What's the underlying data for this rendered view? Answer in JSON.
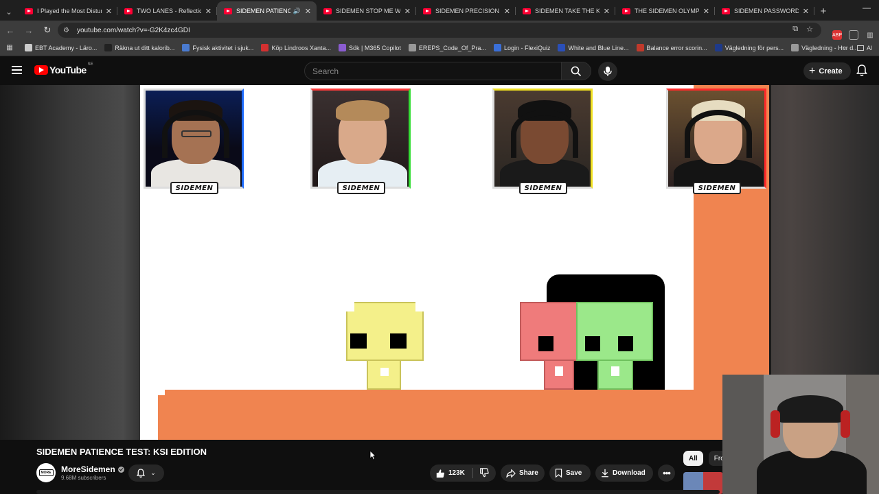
{
  "browser": {
    "tabs": [
      {
        "title": "I Played the Most Disturb",
        "active": false
      },
      {
        "title": "TWO LANES - Reflection",
        "active": false
      },
      {
        "title": "SIDEMEN PATIENCE T",
        "active": true
      },
      {
        "title": "SIDEMEN STOP ME WHE",
        "active": false
      },
      {
        "title": "SIDEMEN PRECISION TES",
        "active": false
      },
      {
        "title": "SIDEMEN TAKE THE KSI T",
        "active": false
      },
      {
        "title": "THE SIDEMEN OLYMPICS",
        "active": false
      },
      {
        "title": "SIDEMEN PASSWORD GA",
        "active": false
      }
    ],
    "url": "youtube.com/watch?v=-G2K4zc4GDI",
    "bookmarks": [
      {
        "label": "EBT Academy - Läro...",
        "color": "#cccccc"
      },
      {
        "label": "Räkna ut ditt kalorib...",
        "color": "#222222"
      },
      {
        "label": "Fysisk aktivitet i sjuk...",
        "color": "#4a7bd0"
      },
      {
        "label": "Köp Lindroos Xanta...",
        "color": "#d33030"
      },
      {
        "label": "Sök | M365 Copilot",
        "color": "#8a5cd0"
      },
      {
        "label": "EREPS_Code_Of_Pra...",
        "color": "#999999"
      },
      {
        "label": "Login - FlexiQuiz",
        "color": "#3a6fd8"
      },
      {
        "label": "White and Blue Line...",
        "color": "#2a4fb8"
      },
      {
        "label": "Balance error scorin...",
        "color": "#c0392b"
      },
      {
        "label": "Vägledning för pers...",
        "color": "#1e3a8a"
      },
      {
        "label": "Vägledning - Hur d...",
        "color": "#999999"
      }
    ],
    "bookmark_folder": "Al"
  },
  "youtube": {
    "logo_text": "YouTube",
    "region": "SE",
    "search_placeholder": "Search",
    "create_label": "Create"
  },
  "video": {
    "title": "SIDEMEN PATIENCE TEST: KSI EDITION",
    "channel": "MoreSidemen",
    "subscribers": "9.68M subscribers",
    "likes": "123K",
    "share_label": "Share",
    "save_label": "Save",
    "download_label": "Download",
    "cam_badges": [
      "SIDEMEN",
      "SIDEMEN",
      "SIDEMEN",
      "SIDEMEN"
    ],
    "cam_accents": [
      "#1e6bff",
      "#33dd33",
      "#f0e020",
      "#ff2a2a"
    ]
  },
  "recommendations": {
    "chips": [
      "All",
      "Fro"
    ]
  },
  "colors": {
    "accent_red": "#ff0000",
    "game_orange": "#f08450",
    "yellow_character": "#f4f08a",
    "pink_character": "#ef7b7b",
    "green_character": "#9be88a"
  }
}
